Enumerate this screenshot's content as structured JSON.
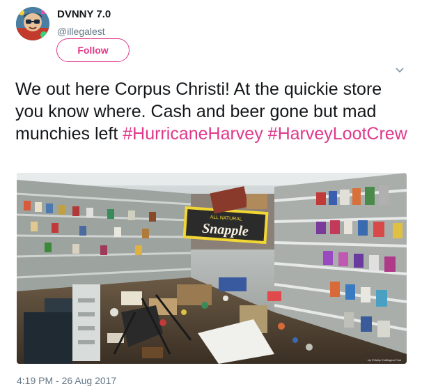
{
  "user": {
    "display_name": "DVNNY 7.0",
    "handle": "@illegalest",
    "follow_label": "Follow"
  },
  "tweet": {
    "text_plain": "We out here Corpus Christi! At the quickie store you know where. Cash and beer gone but mad munchies left",
    "hashtags": [
      "#HurricaneHarvey",
      "#HarveyLootCrew"
    ],
    "photo": {
      "sign_text": "Snapple",
      "sign_subtext": "ALL NATURAL",
      "credit": "Up ©Getty/ Huffington Post"
    },
    "timestamp": "4:19 PM - 26 Aug 2017"
  },
  "icons": {
    "menu": "chevron-down-icon"
  },
  "colors": {
    "accent": "#e0388a",
    "secondary_text": "#657786",
    "primary_text": "#14171a"
  }
}
